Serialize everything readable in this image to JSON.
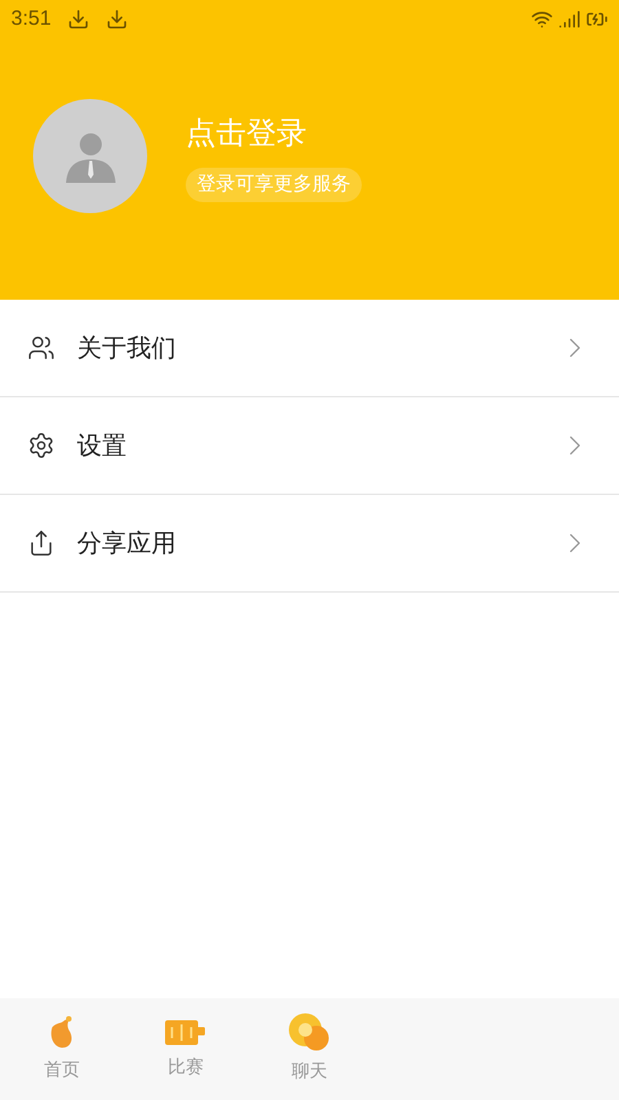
{
  "status_bar": {
    "time": "3:51"
  },
  "profile": {
    "title": "点击登录",
    "subtitle": "登录可享更多服务"
  },
  "menu": [
    {
      "kind": "people",
      "label": "关于我们"
    },
    {
      "kind": "settings",
      "label": "设置"
    },
    {
      "kind": "share",
      "label": "分享应用"
    }
  ],
  "bottom_nav": [
    {
      "kind": "home",
      "label": "首页"
    },
    {
      "kind": "match",
      "label": "比赛"
    },
    {
      "kind": "chat",
      "label": "聊天"
    },
    {
      "kind": "hidden"
    },
    {
      "kind": "hidden"
    }
  ]
}
